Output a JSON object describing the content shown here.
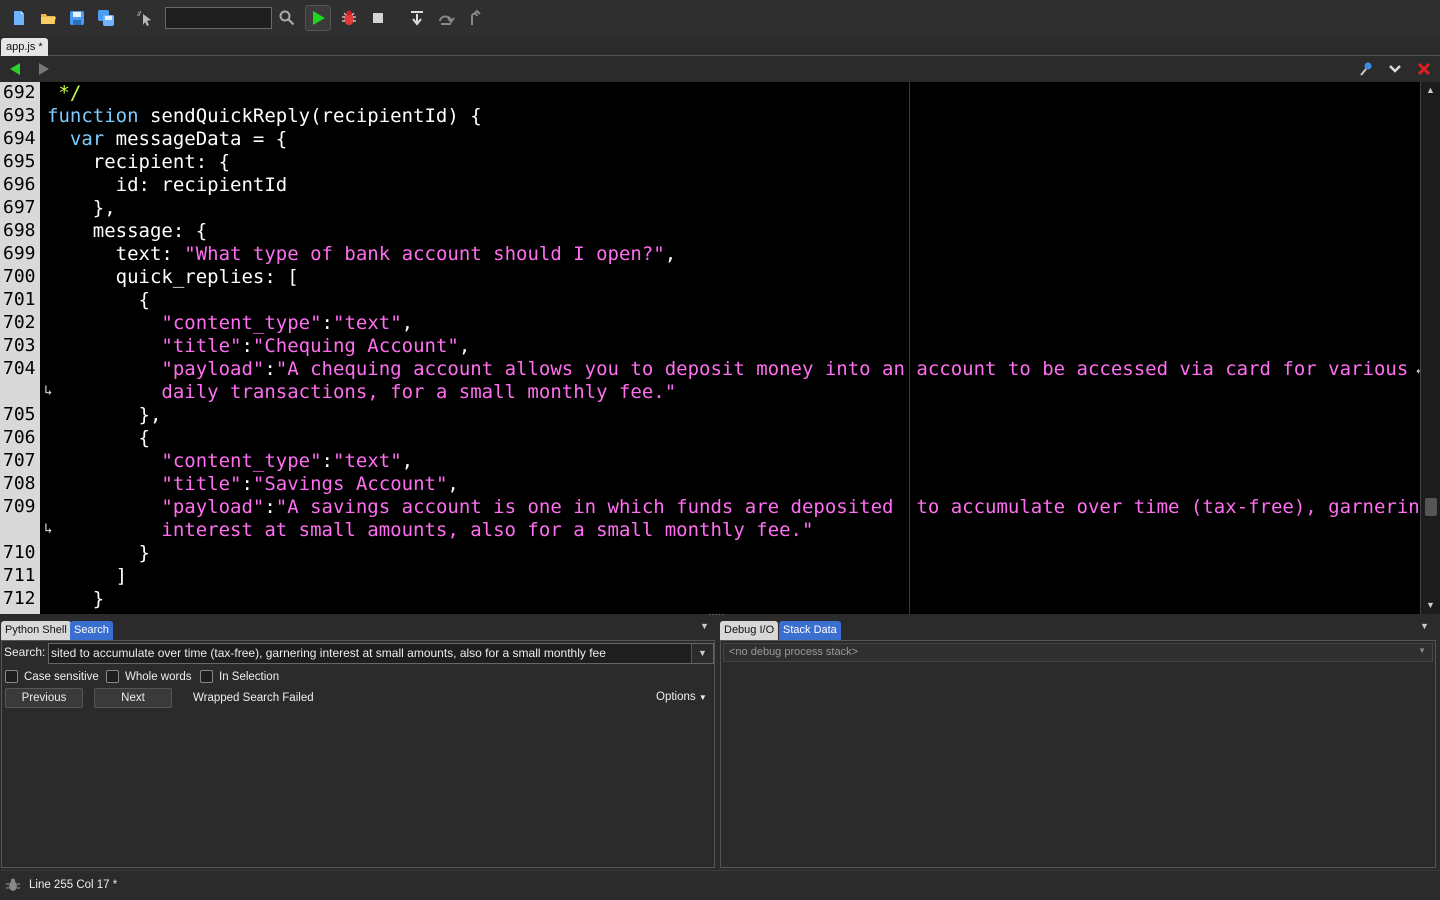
{
  "toolbar": {
    "search_value": "",
    "icons": [
      "new-file-icon",
      "open-folder-icon",
      "save-icon",
      "save-all-icon",
      "select-pointer-icon",
      "search-icon",
      "run-icon",
      "debug-icon",
      "stop-icon",
      "step-into-icon",
      "step-over-icon",
      "step-out-icon"
    ]
  },
  "editor_tab": {
    "label": "app.js *"
  },
  "code": {
    "lines": [
      {
        "n": "692",
        "t": " */"
      },
      {
        "n": "693",
        "t": "function sendQuickReply(recipientId) {"
      },
      {
        "n": "694",
        "t": "  var messageData = {"
      },
      {
        "n": "695",
        "t": "    recipient: {"
      },
      {
        "n": "696",
        "t": "      id: recipientId"
      },
      {
        "n": "697",
        "t": "    },"
      },
      {
        "n": "698",
        "t": "    message: {"
      },
      {
        "n": "699",
        "t": "      text: \"What type of bank account should I open?\","
      },
      {
        "n": "700",
        "t": "      quick_replies: ["
      },
      {
        "n": "701",
        "t": "        {"
      },
      {
        "n": "702",
        "t": "          \"content_type\":\"text\","
      },
      {
        "n": "703",
        "t": "          \"title\":\"Chequing Account\","
      },
      {
        "n": "704",
        "t": "          \"payload\":\"A chequing account allows you to deposit money into an account to be accessed via card for various"
      },
      {
        "n": "",
        "t": "          daily transactions, for a small monthly fee.\""
      },
      {
        "n": "705",
        "t": "        },"
      },
      {
        "n": "706",
        "t": "        {"
      },
      {
        "n": "707",
        "t": "          \"content_type\":\"text\","
      },
      {
        "n": "708",
        "t": "          \"title\":\"Savings Account\","
      },
      {
        "n": "709",
        "t": "          \"payload\":\"A savings account is one in which funds are deposited  to accumulate over time (tax-free), garnering"
      },
      {
        "n": "",
        "t": "          interest at small amounts, also for a small monthly fee.\""
      },
      {
        "n": "710",
        "t": "        }"
      },
      {
        "n": "711",
        "t": "      ]"
      },
      {
        "n": "712",
        "t": "    }"
      }
    ]
  },
  "left_panel": {
    "tabs": [
      "Python Shell",
      "Search"
    ],
    "active_tab": "Search",
    "search_label": "Search:",
    "search_value": "sited  to accumulate over time (tax-free), garnering interest at small amounts, also for a small monthly fee",
    "options": [
      "Case sensitive",
      "Whole words",
      "In Selection"
    ],
    "previous_label": "Previous",
    "next_label": "Next",
    "status": "Wrapped Search Failed",
    "options_label": "Options"
  },
  "right_panel": {
    "tabs": [
      "Debug I/O",
      "Stack Data"
    ],
    "active_tab": "Stack Data",
    "stack_placeholder": "<no debug process stack>"
  },
  "statusbar": {
    "text": "Line 255 Col 17 *"
  },
  "colors": {
    "keyword": "#7ecbff",
    "string": "#ff6ef0",
    "comment": "#c6ff4e",
    "active_tab": "#3a6fd0"
  }
}
